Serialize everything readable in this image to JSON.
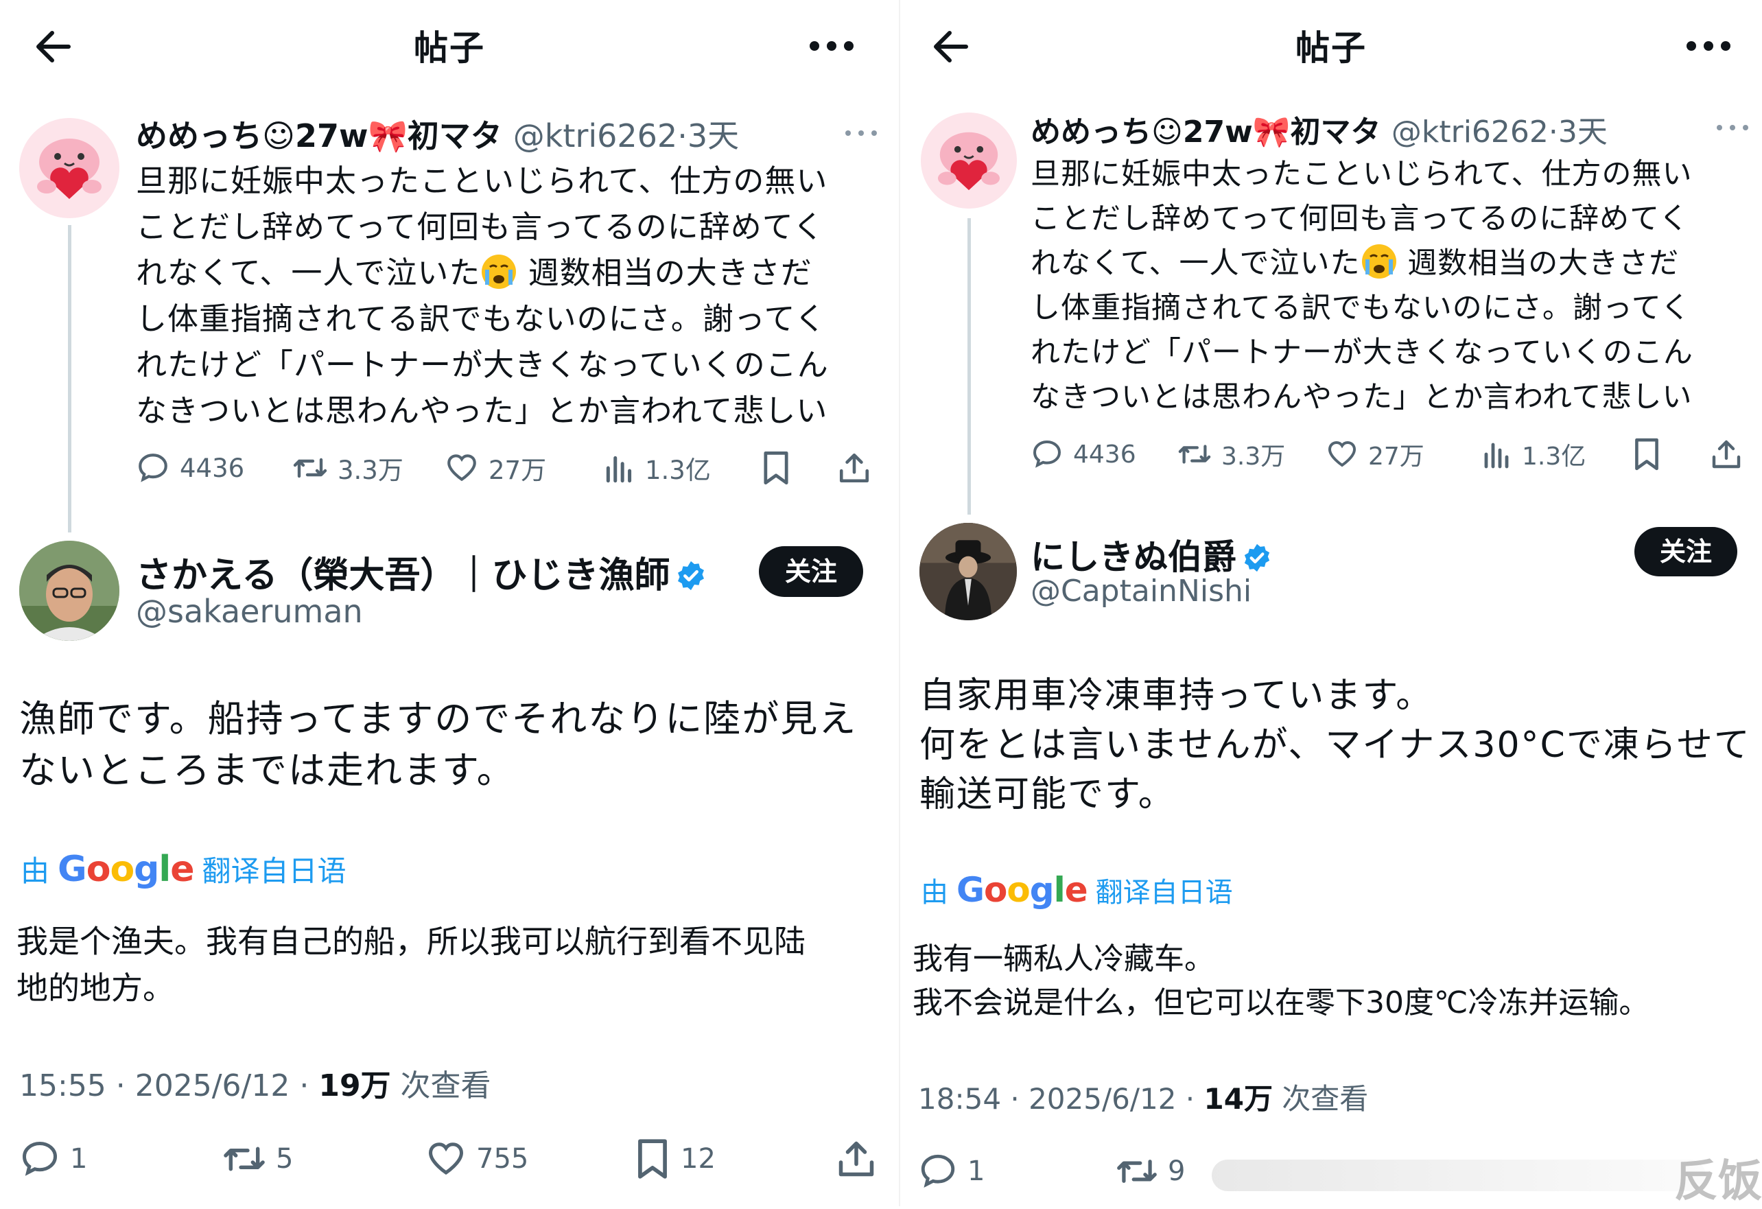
{
  "topbar": {
    "title": "帖子"
  },
  "left": {
    "quoted": {
      "name": "めめっち☺27w🎀初マタ",
      "handle": "@ktri6262",
      "time": "·3天",
      "lines": [
        "旦那に妊娠中太ったこといじられて、仕方の無い",
        "ことだし辞めてって何回も言ってるのに辞めてく",
        "れなくて、一人で泣いた",
        "し体重指摘されてる訳でもないのにさ。謝ってく",
        "れたけど「パートナーが大きくなっていくのこん",
        "なきついとは思わんやった」とか言われて悲しい"
      ],
      "line3_after": " 週数相当の大きさだ",
      "stats": {
        "replies": "4436",
        "retweets": "3.3万",
        "likes": "27万",
        "views": "1.3亿"
      }
    },
    "author": {
      "name": "さかえる（榮大吾）｜ひじき漁師",
      "handle": "@sakaeruman",
      "follow_label": "关注"
    },
    "text_lines": [
      "漁師です。船持ってますのでそれなりに陸が見え",
      "ないところまでは走れます。"
    ],
    "translate": {
      "prefix": "由",
      "brand": "Google",
      "suffix": "翻译自日语"
    },
    "translation_lines": [
      "我是个渔夫。我有自己的船，所以我可以航行到看不见陆",
      "地的地方。"
    ],
    "meta": {
      "time": "15:55 · 2025/6/12 · ",
      "views": "19万",
      "views_suffix": " 次查看"
    },
    "actions": {
      "replies": "1",
      "retweets": "5",
      "likes": "755",
      "bookmarks": "12"
    }
  },
  "right": {
    "quoted": {
      "name": "めめっち☺27w🎀初マタ",
      "handle": "@ktri6262",
      "time": "·3天",
      "lines": [
        "旦那に妊娠中太ったこといじられて、仕方の無い",
        "ことだし辞めてって何回も言ってるのに辞めてく",
        "れなくて、一人で泣いた",
        "し体重指摘されてる訳でもないのにさ。謝ってく",
        "れたけど「パートナーが大きくなっていくのこん",
        "なきついとは思わんやった」とか言われて悲しい"
      ],
      "line3_after": " 週数相当の大きさだ",
      "stats": {
        "replies": "4436",
        "retweets": "3.3万",
        "likes": "27万",
        "views": "1.3亿"
      }
    },
    "author": {
      "name": "にしきぬ伯爵",
      "handle": "@CaptainNishi",
      "follow_label": "关注"
    },
    "text_lines": [
      "自家用車冷凍車持っています。",
      "何をとは言いませんが、マイナス30°Cで凍らせて",
      "輸送可能です。"
    ],
    "translate": {
      "prefix": "由",
      "brand": "Google",
      "suffix": "翻译自日语"
    },
    "translation_lines": [
      "我有一辆私人冷藏车。",
      "我不会说是什么，但它可以在零下30度℃冷冻并运输。"
    ],
    "meta": {
      "time": "18:54 · 2025/6/12 · ",
      "views": "14万",
      "views_suffix": " 次查看"
    },
    "actions": {
      "replies": "1",
      "retweets": "9"
    }
  },
  "watermark": "反饭",
  "colors": {
    "text": "#0f1419",
    "secondary": "#536471",
    "accent": "#1d9bf0",
    "verified": "#1d9bf0"
  }
}
